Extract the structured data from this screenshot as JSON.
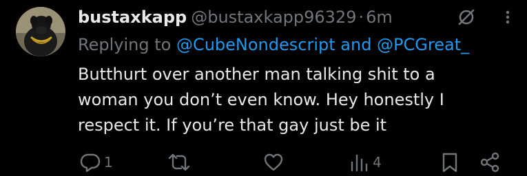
{
  "tweet": {
    "display_name": "bustaxkapp",
    "handle": "@bustaxkapp96329",
    "separator": "·",
    "time": "6m",
    "reply": {
      "prefix": "Replying to",
      "mentions": "@CubeNondescript and @PCGreat_"
    },
    "body_lines": [
      "Butthurt over another man talking shit to a",
      "woman you don’t even know. Hey honestly I",
      "respect it. If you’re that gay just be it"
    ],
    "icons": {
      "header_right": [
        "grok-icon",
        "more-icon"
      ],
      "actions": [
        "reply-icon",
        "retweet-icon",
        "like-icon",
        "views-icon",
        "bookmark-icon",
        "share-icon"
      ]
    },
    "actions": {
      "reply_count": "1",
      "retweet_count": "",
      "like_count": "",
      "views_count": "4"
    }
  },
  "colors": {
    "background": "#000000",
    "text": "#e7e9ea",
    "secondary": "#71767b",
    "mention": "#1d9bf0"
  }
}
